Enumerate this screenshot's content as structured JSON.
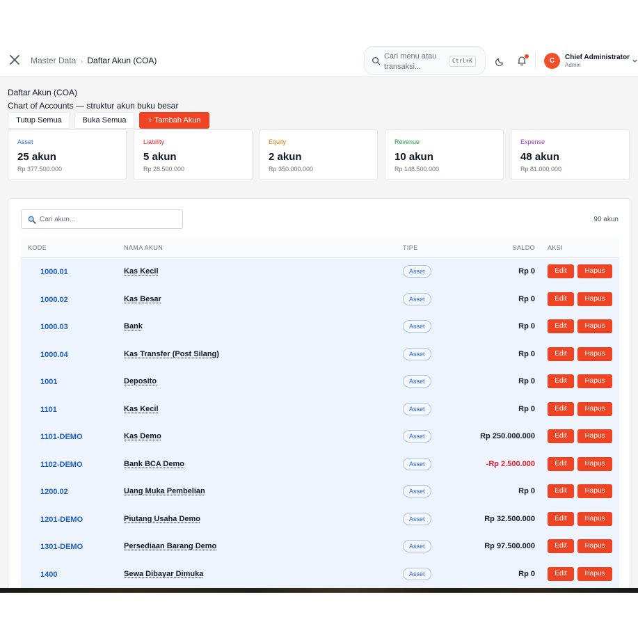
{
  "header": {
    "breadcrumb": {
      "parent": "Master Data",
      "separator": "›",
      "current": "Daftar Akun (COA)"
    },
    "search": {
      "placeholder": "Cari menu atau transaksi...",
      "shortcut": "Ctrl+K"
    },
    "user": {
      "initial": "C",
      "name": "Chief Administrator",
      "role": "Admin"
    },
    "icons": [
      "close-icon",
      "search-icon",
      "moon-icon",
      "bell-icon",
      "chevron-down-icon"
    ],
    "notification_color": "#ef4423"
  },
  "page": {
    "title": "Daftar Akun (COA)",
    "subtitle": "Chart of Accounts — struktur akun buku besar",
    "buttons": {
      "collapse_all": "Tutup Semua",
      "expand_all": "Buka Semua",
      "add_account": "+ Tambah Akun"
    }
  },
  "summary": [
    {
      "label": "Asset",
      "count": "25 akun",
      "amount": "Rp 377.500.000",
      "color": "#2563eb"
    },
    {
      "label": "Liability",
      "count": "5 akun",
      "amount": "Rp 28.500.000",
      "color": "#dc2626"
    },
    {
      "label": "Equity",
      "count": "2 akun",
      "amount": "Rp 350.000.000",
      "color": "#d97706"
    },
    {
      "label": "Revenue",
      "count": "10 akun",
      "amount": "Rp 148.500.000",
      "color": "#16a34a"
    },
    {
      "label": "Expense",
      "count": "48 akun",
      "amount": "Rp 81.000.000",
      "color": "#9333ea"
    }
  ],
  "table": {
    "search_placeholder": "Cari akun...",
    "total": "90 akun",
    "columns": [
      "KODE",
      "NAMA AKUN",
      "TIPE",
      "SALDO",
      "AKSI"
    ],
    "edit_label": "Edit",
    "delete_label": "Hapus",
    "rows": [
      {
        "code": "1000.01",
        "name": "Kas Kecil",
        "type": "Asset",
        "saldo": "Rp 0"
      },
      {
        "code": "1000.02",
        "name": "Kas Besar",
        "type": "Asset",
        "saldo": "Rp 0"
      },
      {
        "code": "1000.03",
        "name": "Bank",
        "type": "Asset",
        "saldo": "Rp 0"
      },
      {
        "code": "1000.04",
        "name": "Kas Transfer (Post Silang)",
        "type": "Asset",
        "saldo": "Rp 0"
      },
      {
        "code": "1001",
        "name": "Deposito",
        "type": "Asset",
        "saldo": "Rp 0"
      },
      {
        "code": "1101",
        "name": "Kas Kecil",
        "type": "Asset",
        "saldo": "Rp 0"
      },
      {
        "code": "1101-DEMO",
        "name": "Kas Demo",
        "type": "Asset",
        "saldo": "Rp 250.000.000"
      },
      {
        "code": "1102-DEMO",
        "name": "Bank BCA Demo",
        "type": "Asset",
        "saldo": "-Rp 2.500.000",
        "negative": true
      },
      {
        "code": "1200.02",
        "name": "Uang Muka Pembelian",
        "type": "Asset",
        "saldo": "Rp 0"
      },
      {
        "code": "1201-DEMO",
        "name": "Piutang Usaha Demo",
        "type": "Asset",
        "saldo": "Rp 32.500.000"
      },
      {
        "code": "1301-DEMO",
        "name": "Persediaan Barang Demo",
        "type": "Asset",
        "saldo": "Rp 97.500.000"
      },
      {
        "code": "1400",
        "name": "Sewa Dibayar Dimuka",
        "type": "Asset",
        "saldo": "Rp 0"
      }
    ]
  },
  "colors": {
    "accent": "#ef4423",
    "code_link": "#1d5fc9",
    "row_bg": "#eef4fd",
    "negative": "#e11d2b"
  }
}
